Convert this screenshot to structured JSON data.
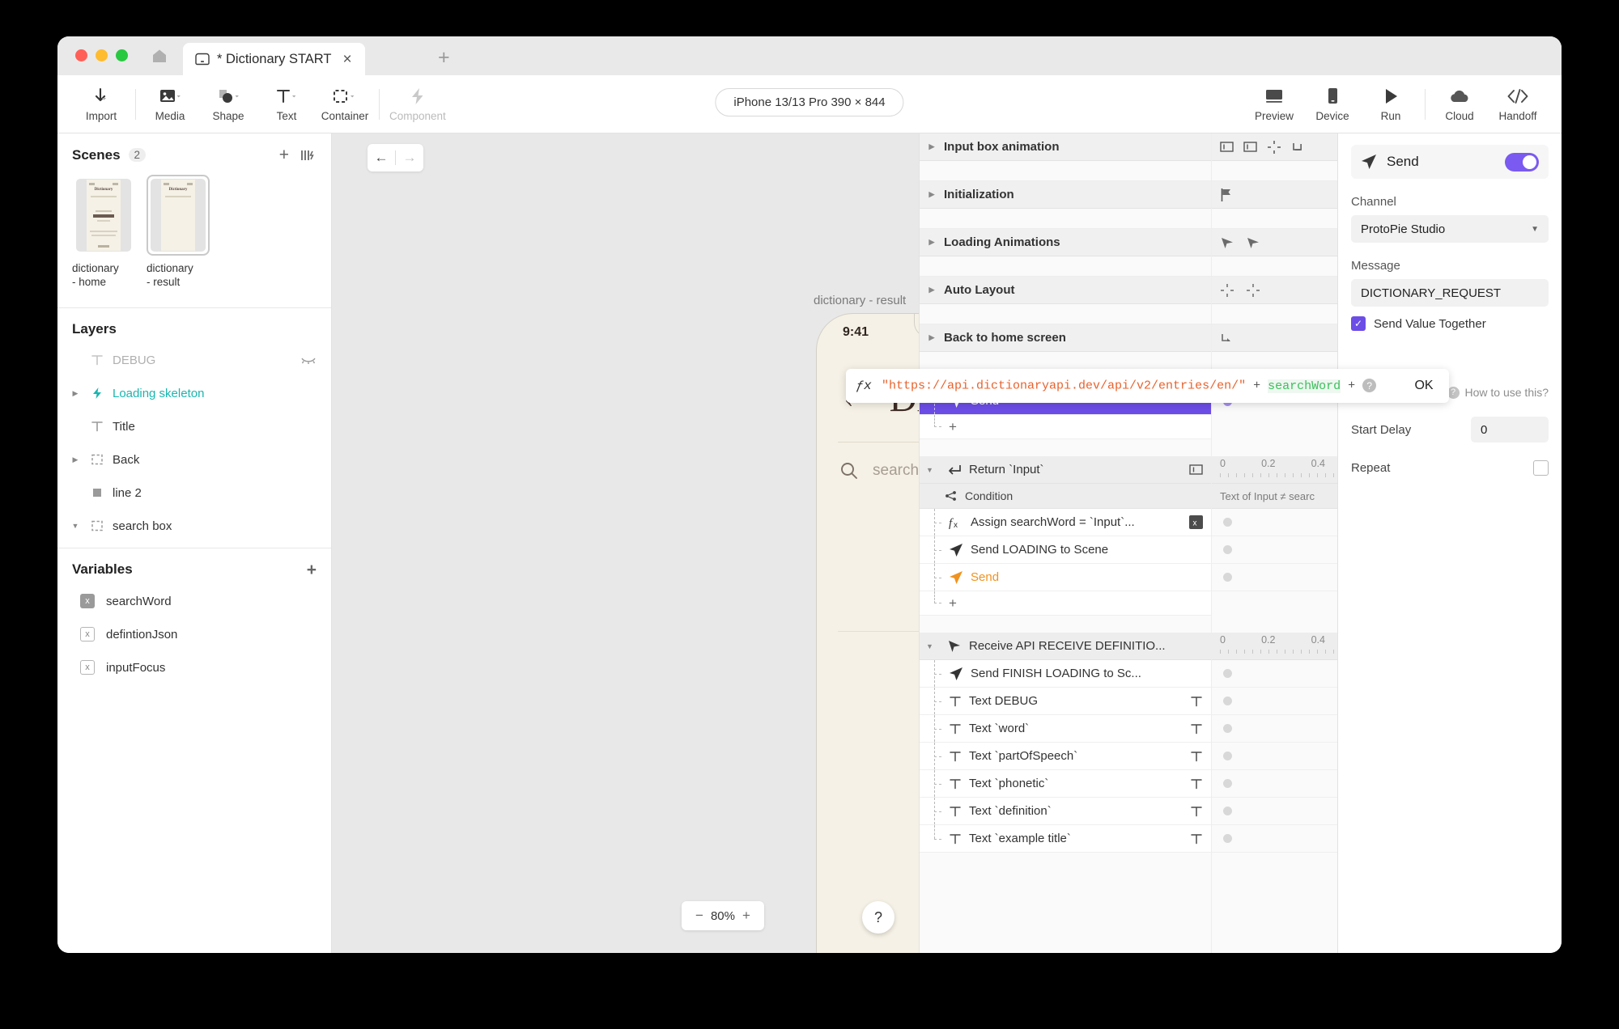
{
  "window": {
    "tab_title": "* Dictionary START",
    "tab_close": "×",
    "new_tab": "+"
  },
  "toolbar": {
    "items": [
      {
        "label": "Import",
        "icon": "download-arrow-icon",
        "disabled": false,
        "caret": true
      },
      {
        "label": "Media",
        "icon": "image-icon",
        "disabled": false,
        "caret": true
      },
      {
        "label": "Shape",
        "icon": "shape-icon",
        "disabled": false,
        "caret": true
      },
      {
        "label": "Text",
        "icon": "text-icon",
        "disabled": false,
        "caret": true
      },
      {
        "label": "Container",
        "icon": "container-icon",
        "disabled": false,
        "caret": true
      },
      {
        "label": "Component",
        "icon": "component-icon",
        "disabled": true,
        "caret": false
      }
    ],
    "device_pill": "iPhone 13/13 Pro  390 × 844",
    "right_items": [
      {
        "label": "Preview",
        "icon": "preview-icon"
      },
      {
        "label": "Device",
        "icon": "device-icon"
      },
      {
        "label": "Run",
        "icon": "play-icon"
      },
      {
        "label": "Cloud",
        "icon": "cloud-icon"
      },
      {
        "label": "Handoff",
        "icon": "code-icon"
      }
    ]
  },
  "scenes": {
    "title": "Scenes",
    "count": "2",
    "add": "+",
    "list": [
      {
        "name": "dictionary\n- home",
        "selected": false,
        "mini_title": "Dictionary"
      },
      {
        "name": "dictionary\n- result",
        "selected": true,
        "mini_title": "Dictionary"
      }
    ]
  },
  "layers": {
    "title": "Layers",
    "items": [
      {
        "label": "DEBUG",
        "icon": "text-layer-icon",
        "twist": "",
        "dim": true,
        "accent": false,
        "right_icon": "hidden-eye-icon"
      },
      {
        "label": "Loading skeleton",
        "icon": "component-bolt-icon",
        "twist": "▶",
        "dim": false,
        "accent": true,
        "right_icon": ""
      },
      {
        "label": "Title",
        "icon": "text-layer-icon",
        "twist": "",
        "dim": false,
        "accent": false,
        "right_icon": ""
      },
      {
        "label": "Back",
        "icon": "container-layer-icon",
        "twist": "▶",
        "dim": false,
        "accent": false,
        "right_icon": ""
      },
      {
        "label": "line 2",
        "icon": "rect-layer-icon",
        "twist": "",
        "dim": false,
        "accent": false,
        "right_icon": ""
      },
      {
        "label": "search box",
        "icon": "container-layer-icon",
        "twist": "▼",
        "dim": false,
        "accent": false,
        "right_icon": ""
      }
    ]
  },
  "variables": {
    "title": "Variables",
    "add": "+",
    "items": [
      {
        "label": "searchWord",
        "chip": "x",
        "filled": true
      },
      {
        "label": "defintionJson",
        "chip": "x",
        "filled": false
      },
      {
        "label": "inputFocus",
        "chip": "x",
        "filled": false
      }
    ]
  },
  "canvas": {
    "back_arrow": "←",
    "forward_arrow": "→",
    "scene_label": "dictionary - result",
    "zoom": "80%",
    "zoom_out": "−",
    "zoom_in": "+",
    "help": "?",
    "phone": {
      "time": "9:41",
      "title": "Dictionary",
      "back_chevron": "‹",
      "search_placeholder": "search for a word..."
    }
  },
  "interactions": {
    "groups": [
      {
        "label": "Input box animation",
        "icons": [
          "keyboard-show-icon",
          "keyboard-hide-icon",
          "auto-layout-icon",
          "receive-icon"
        ]
      },
      {
        "label": "Initialization",
        "icons": [
          "flag-icon"
        ]
      },
      {
        "label": "Loading Animations",
        "icons": [
          "receive-icon",
          "receive-icon"
        ]
      },
      {
        "label": "Auto Layout",
        "icons": [
          "auto-layout-icon",
          "auto-layout-icon"
        ]
      },
      {
        "label": "Back to home screen",
        "icons": [
          "tap-icon"
        ]
      }
    ],
    "rows": [
      {
        "kind": "action",
        "label": "Send",
        "icon": "send-icon",
        "selected": true,
        "orange": false,
        "right_icon": "",
        "dot": "purple",
        "last": false
      },
      {
        "kind": "plus",
        "label": "+"
      },
      {
        "kind": "gap"
      },
      {
        "kind": "trigger",
        "label": "Return `Input`",
        "icon": "return-icon",
        "right_icon": "keyboard-icon",
        "ruler": [
          "0",
          "0.2",
          "0.4"
        ],
        "caption": ""
      },
      {
        "kind": "condition",
        "label": "Condition",
        "icon": "condition-icon",
        "caption": "Text of Input ≠ searc"
      },
      {
        "kind": "action",
        "label": "Assign searchWord = `Input`...",
        "icon": "formula-icon",
        "selected": false,
        "orange": false,
        "right_icon": "var-icon",
        "dot": "grey",
        "last": false
      },
      {
        "kind": "action",
        "label": "Send LOADING to Scene",
        "icon": "send-icon",
        "selected": false,
        "orange": false,
        "right_icon": "",
        "dot": "grey",
        "last": false
      },
      {
        "kind": "action",
        "label": "Send",
        "icon": "send-icon",
        "selected": false,
        "orange": true,
        "right_icon": "",
        "dot": "grey",
        "last": false,
        "marker": true
      },
      {
        "kind": "plus",
        "label": "+"
      },
      {
        "kind": "trigger",
        "label": "Receive API RECEIVE DEFINITIO...",
        "icon": "receive-icon",
        "right_icon": "",
        "ruler": [
          "0",
          "0.2",
          "0.4"
        ],
        "caption": ""
      },
      {
        "kind": "action",
        "label": "Send FINISH LOADING to Sc...",
        "icon": "send-icon",
        "selected": false,
        "orange": false,
        "right_icon": "",
        "dot": "grey",
        "last": false
      },
      {
        "kind": "action",
        "label": "Text DEBUG",
        "icon": "text-icon",
        "selected": false,
        "orange": false,
        "right_icon": "text-icon",
        "dot": "grey",
        "last": false
      },
      {
        "kind": "action",
        "label": "Text `word`",
        "icon": "text-icon",
        "selected": false,
        "orange": false,
        "right_icon": "text-icon",
        "dot": "grey",
        "last": false
      },
      {
        "kind": "action",
        "label": "Text `partOfSpeech`",
        "icon": "text-icon",
        "selected": false,
        "orange": false,
        "right_icon": "text-icon",
        "dot": "grey",
        "last": false
      },
      {
        "kind": "action",
        "label": "Text `phonetic`",
        "icon": "text-icon",
        "selected": false,
        "orange": false,
        "right_icon": "text-icon",
        "dot": "grey",
        "last": false
      },
      {
        "kind": "action",
        "label": "Text `definition`",
        "icon": "text-icon",
        "selected": false,
        "orange": false,
        "right_icon": "text-icon",
        "dot": "grey",
        "last": false
      },
      {
        "kind": "action",
        "label": "Text `example title`",
        "icon": "text-icon",
        "selected": false,
        "orange": false,
        "right_icon": "text-icon",
        "dot": "grey",
        "last": true
      }
    ]
  },
  "formula": {
    "fx": "ƒx",
    "string_part": "\"https://api.dictionaryapi.dev/api/v2/entries/en/\"",
    "plus1": "+",
    "variable": "searchWord",
    "plus2": "+",
    "help": "?",
    "ok": "OK"
  },
  "properties": {
    "header": "Send",
    "header_icon": "send-icon",
    "channel_label": "Channel",
    "channel_value": "ProtoPie Studio",
    "message_label": "Message",
    "message_value": "DICTIONARY_REQUEST",
    "send_value_together": "Send Value Together",
    "how_to_use": "How to use this?",
    "start_delay_label": "Start Delay",
    "start_delay_value": "0",
    "repeat_label": "Repeat"
  },
  "colors": {
    "accent_purple": "#6c4de6",
    "accent_orange": "#f0921e",
    "accent_teal": "#19b6b0",
    "phone_bg": "#f5f1e6",
    "canvas_bg": "#e8e8e8"
  }
}
